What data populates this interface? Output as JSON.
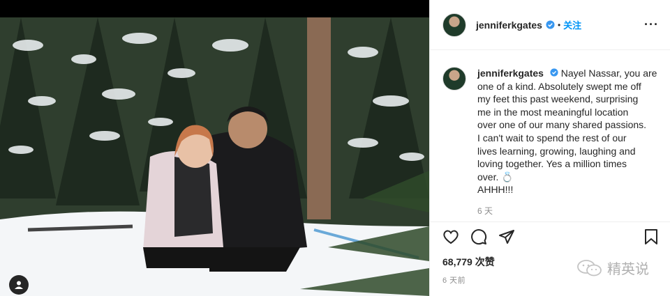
{
  "post": {
    "username": "jenniferkgates",
    "follow_label": "关注",
    "separator": "•",
    "more_label": "···",
    "caption_lines": [
      "Nayel Nassar, you are",
      "one of a kind. Absolutely swept me off",
      "my feet this past weekend, surprising",
      "me in the most meaningful location",
      "over one of our many shared passions.",
      "I can't wait to spend the rest of our",
      "lives learning, growing, laughing and",
      "loving together. Yes a million times",
      "over. 💍",
      "AHHH!!!"
    ],
    "caption_age": "6 天",
    "likes": "68,779 次赞",
    "posted": "6 天前"
  },
  "watermark": {
    "text": "精英说"
  },
  "colors": {
    "accent": "#0095f6",
    "verified": "#3897f0",
    "text": "#262626",
    "muted": "#8e8e8e"
  }
}
